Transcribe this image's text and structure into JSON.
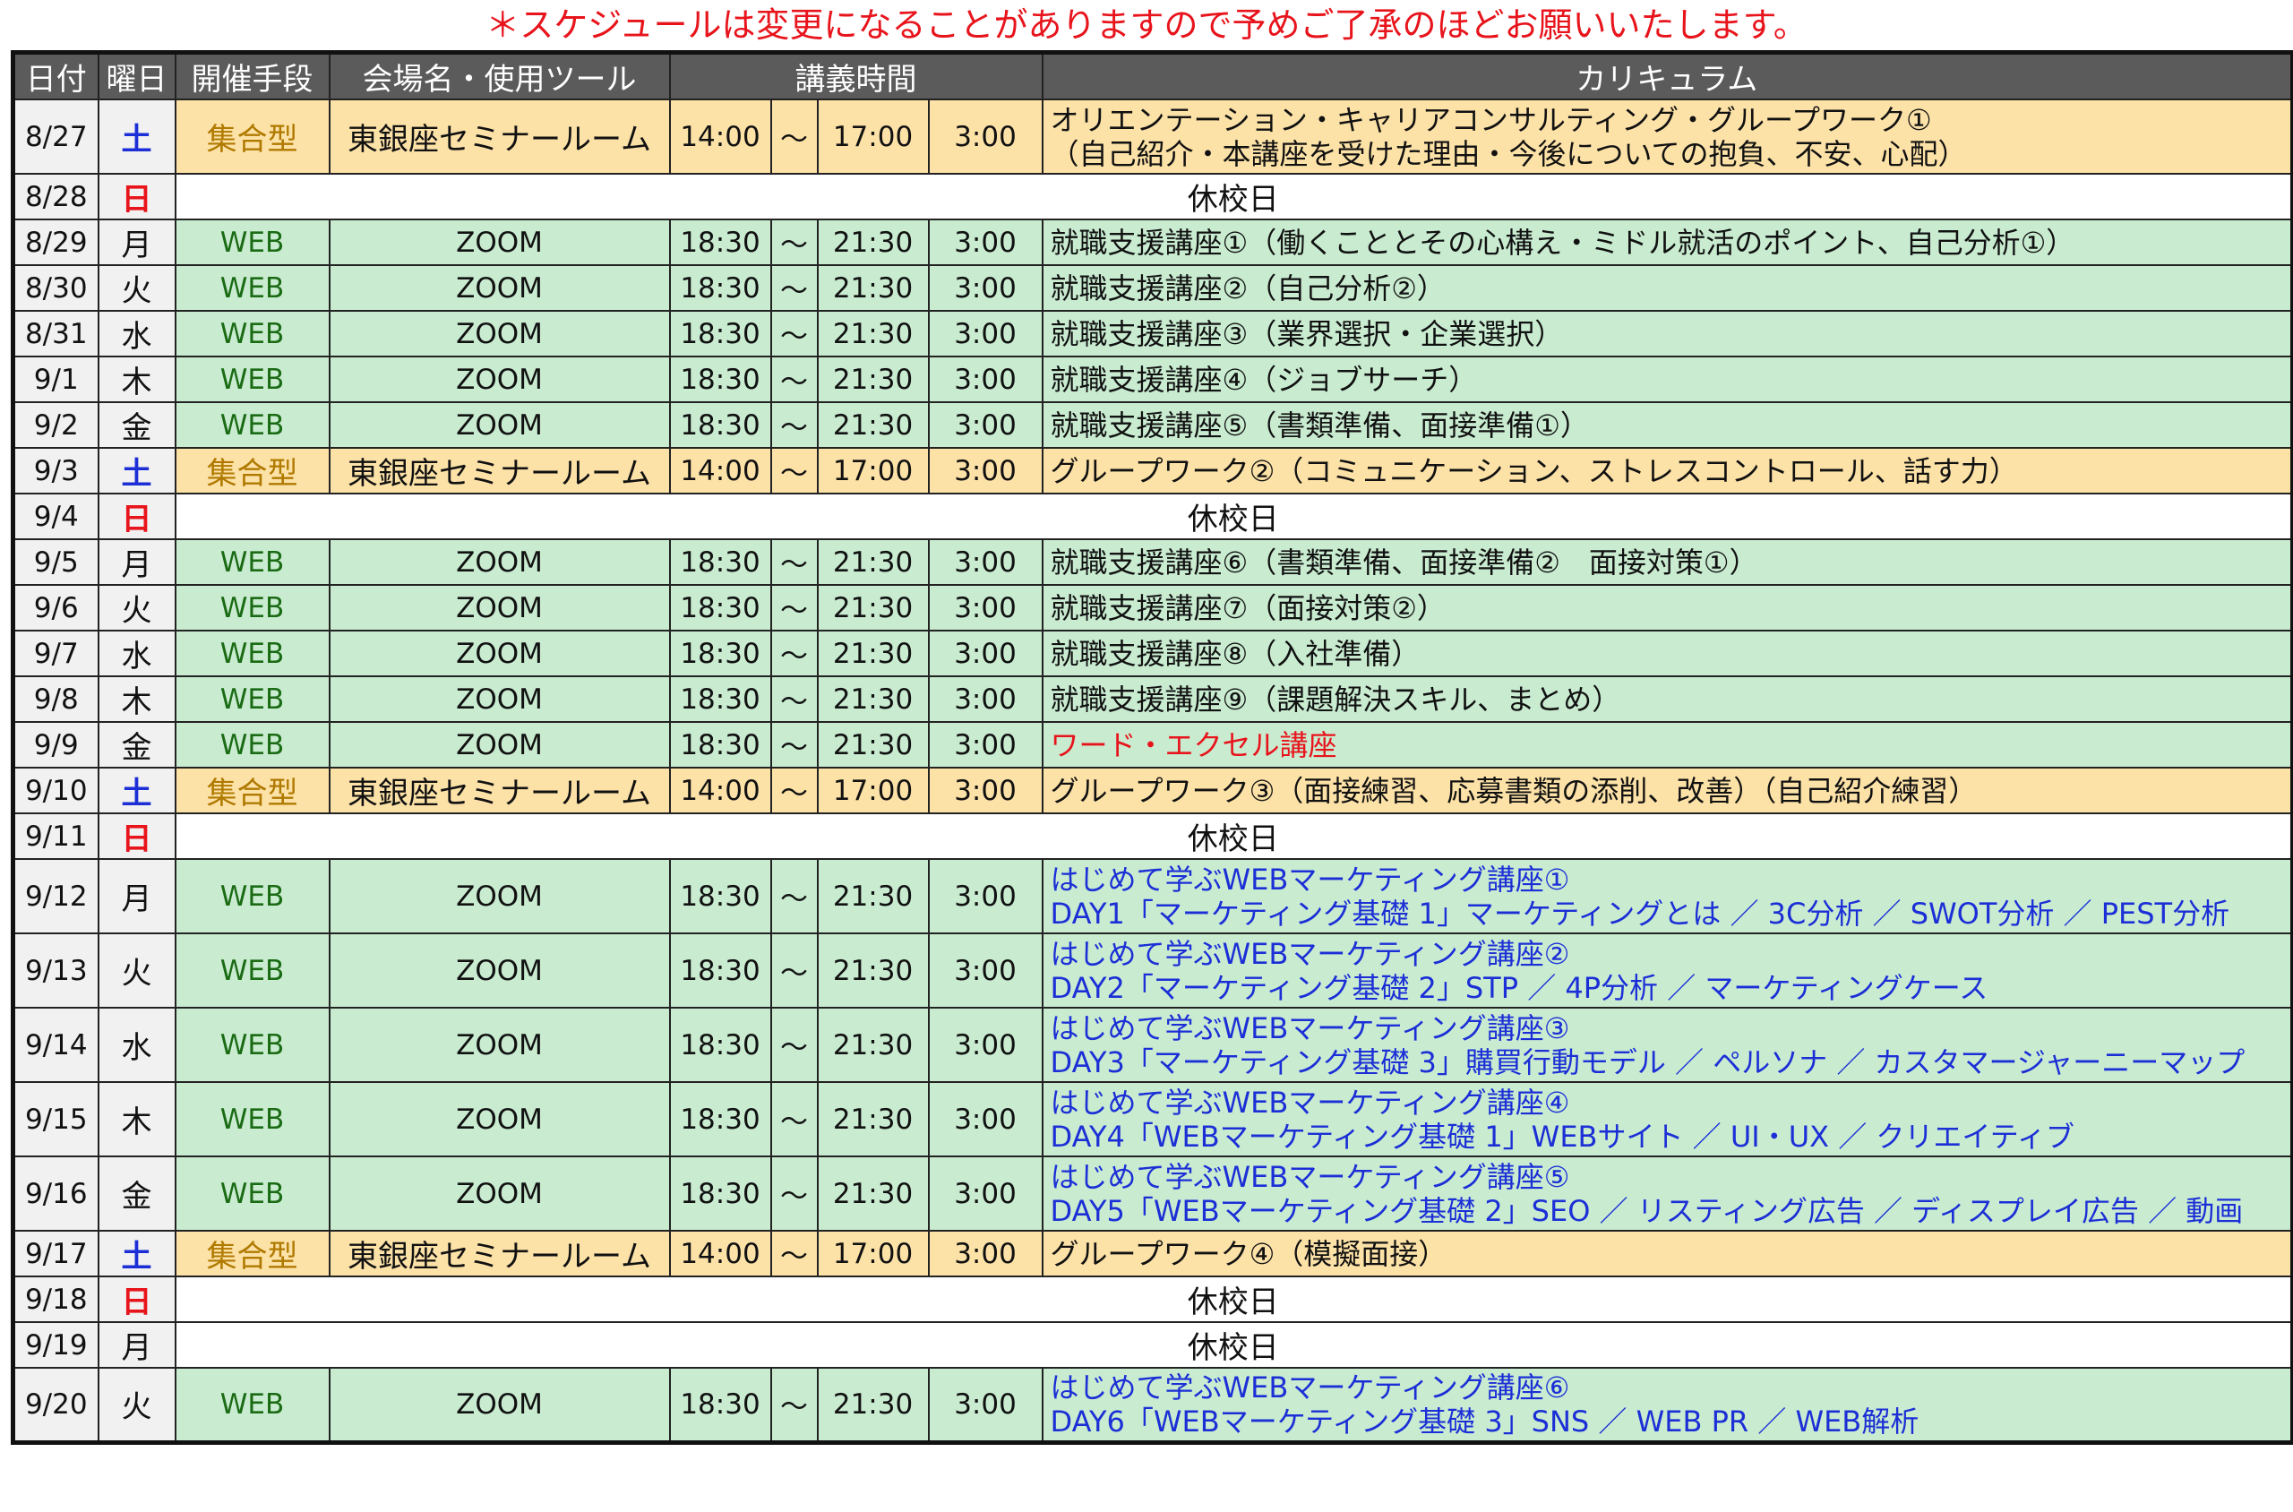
{
  "notice": "＊スケジュールは変更になることがありますので予めご了承のほどお願いいたします。",
  "headers": [
    "日付",
    "曜日",
    "開催手段",
    "会場名・使用ツール",
    "講義時間",
    "カリキュラム"
  ],
  "rows": [
    {
      "date": "8/27",
      "dow": "土",
      "dow_color": "blue",
      "type": "group",
      "method": "集合型",
      "venue": "東銀座セミナールーム",
      "start": "14:00",
      "sep": "〜",
      "end": "17:00",
      "dur": "3:00",
      "curr": [
        "オリエンテーション・キャリアコンサルティング・グループワーク①",
        "（自己紹介・本講座を受けた理由・今後についての抱負、不安、心配）"
      ],
      "curr_color": "black"
    },
    {
      "date": "8/28",
      "dow": "日",
      "dow_color": "red",
      "type": "holiday",
      "holiday": "休校日"
    },
    {
      "date": "8/29",
      "dow": "月",
      "dow_color": "black",
      "type": "web",
      "method": "WEB",
      "venue": "ZOOM",
      "start": "18:30",
      "sep": "〜",
      "end": "21:30",
      "dur": "3:00",
      "curr": [
        "就職支援講座①（働くこととその心構え・ミドル就活のポイント、自己分析①）"
      ],
      "curr_color": "black"
    },
    {
      "date": "8/30",
      "dow": "火",
      "dow_color": "black",
      "type": "web",
      "method": "WEB",
      "venue": "ZOOM",
      "start": "18:30",
      "sep": "〜",
      "end": "21:30",
      "dur": "3:00",
      "curr": [
        "就職支援講座②（自己分析②）"
      ],
      "curr_color": "black"
    },
    {
      "date": "8/31",
      "dow": "水",
      "dow_color": "black",
      "type": "web",
      "method": "WEB",
      "venue": "ZOOM",
      "start": "18:30",
      "sep": "〜",
      "end": "21:30",
      "dur": "3:00",
      "curr": [
        "就職支援講座③（業界選択・企業選択）"
      ],
      "curr_color": "black"
    },
    {
      "date": "9/1",
      "dow": "木",
      "dow_color": "black",
      "type": "web",
      "method": "WEB",
      "venue": "ZOOM",
      "start": "18:30",
      "sep": "〜",
      "end": "21:30",
      "dur": "3:00",
      "curr": [
        "就職支援講座④（ジョブサーチ）"
      ],
      "curr_color": "black"
    },
    {
      "date": "9/2",
      "dow": "金",
      "dow_color": "black",
      "type": "web",
      "method": "WEB",
      "venue": "ZOOM",
      "start": "18:30",
      "sep": "〜",
      "end": "21:30",
      "dur": "3:00",
      "curr": [
        "就職支援講座⑤（書類準備、面接準備①）"
      ],
      "curr_color": "black"
    },
    {
      "date": "9/3",
      "dow": "土",
      "dow_color": "blue",
      "type": "group",
      "method": "集合型",
      "venue": "東銀座セミナールーム",
      "start": "14:00",
      "sep": "〜",
      "end": "17:00",
      "dur": "3:00",
      "curr": [
        "グループワーク②（コミュニケーション、ストレスコントロール、話す力）"
      ],
      "curr_color": "black"
    },
    {
      "date": "9/4",
      "dow": "日",
      "dow_color": "red",
      "type": "holiday",
      "holiday": "休校日"
    },
    {
      "date": "9/5",
      "dow": "月",
      "dow_color": "black",
      "type": "web",
      "method": "WEB",
      "venue": "ZOOM",
      "start": "18:30",
      "sep": "〜",
      "end": "21:30",
      "dur": "3:00",
      "curr": [
        "就職支援講座⑥（書類準備、面接準備②　面接対策①）"
      ],
      "curr_color": "black"
    },
    {
      "date": "9/6",
      "dow": "火",
      "dow_color": "black",
      "type": "web",
      "method": "WEB",
      "venue": "ZOOM",
      "start": "18:30",
      "sep": "〜",
      "end": "21:30",
      "dur": "3:00",
      "curr": [
        "就職支援講座⑦（面接対策②）"
      ],
      "curr_color": "black"
    },
    {
      "date": "9/7",
      "dow": "水",
      "dow_color": "black",
      "type": "web",
      "method": "WEB",
      "venue": "ZOOM",
      "start": "18:30",
      "sep": "〜",
      "end": "21:30",
      "dur": "3:00",
      "curr": [
        "就職支援講座⑧（入社準備）"
      ],
      "curr_color": "black"
    },
    {
      "date": "9/8",
      "dow": "木",
      "dow_color": "black",
      "type": "web",
      "method": "WEB",
      "venue": "ZOOM",
      "start": "18:30",
      "sep": "〜",
      "end": "21:30",
      "dur": "3:00",
      "curr": [
        "就職支援講座⑨（課題解決スキル、まとめ）"
      ],
      "curr_color": "black"
    },
    {
      "date": "9/9",
      "dow": "金",
      "dow_color": "black",
      "type": "web",
      "method": "WEB",
      "venue": "ZOOM",
      "start": "18:30",
      "sep": "〜",
      "end": "21:30",
      "dur": "3:00",
      "curr": [
        "ワード・エクセル講座"
      ],
      "curr_color": "red"
    },
    {
      "date": "9/10",
      "dow": "土",
      "dow_color": "blue",
      "type": "group",
      "method": "集合型",
      "venue": "東銀座セミナールーム",
      "start": "14:00",
      "sep": "〜",
      "end": "17:00",
      "dur": "3:00",
      "curr": [
        "グループワーク③（面接練習、応募書類の添削、改善）（自己紹介練習）"
      ],
      "curr_color": "black"
    },
    {
      "date": "9/11",
      "dow": "日",
      "dow_color": "red",
      "type": "holiday",
      "holiday": "休校日"
    },
    {
      "date": "9/12",
      "dow": "月",
      "dow_color": "black",
      "type": "web",
      "method": "WEB",
      "venue": "ZOOM",
      "start": "18:30",
      "sep": "〜",
      "end": "21:30",
      "dur": "3:00",
      "curr": [
        "はじめて学ぶWEBマーケティング講座①",
        "DAY1「マーケティング基礎 1」マーケティングとは ／ 3C分析 ／ SWOT分析 ／ PEST分析"
      ],
      "curr_color": "blue"
    },
    {
      "date": "9/13",
      "dow": "火",
      "dow_color": "black",
      "type": "web",
      "method": "WEB",
      "venue": "ZOOM",
      "start": "18:30",
      "sep": "〜",
      "end": "21:30",
      "dur": "3:00",
      "curr": [
        "はじめて学ぶWEBマーケティング講座②",
        "DAY2「マーケティング基礎 2」STP ／ 4P分析 ／ マーケティングケース"
      ],
      "curr_color": "blue"
    },
    {
      "date": "9/14",
      "dow": "水",
      "dow_color": "black",
      "type": "web",
      "method": "WEB",
      "venue": "ZOOM",
      "start": "18:30",
      "sep": "〜",
      "end": "21:30",
      "dur": "3:00",
      "curr": [
        "はじめて学ぶWEBマーケティング講座③",
        "DAY3「マーケティング基礎 3」購買行動モデル ／ ペルソナ ／ カスタマージャーニーマップ"
      ],
      "curr_color": "blue"
    },
    {
      "date": "9/15",
      "dow": "木",
      "dow_color": "black",
      "type": "web",
      "method": "WEB",
      "venue": "ZOOM",
      "start": "18:30",
      "sep": "〜",
      "end": "21:30",
      "dur": "3:00",
      "curr": [
        "はじめて学ぶWEBマーケティング講座④",
        "DAY4「WEBマーケティング基礎 1」WEBサイト ／ UI・UX ／ クリエイティブ"
      ],
      "curr_color": "blue"
    },
    {
      "date": "9/16",
      "dow": "金",
      "dow_color": "black",
      "type": "web",
      "method": "WEB",
      "venue": "ZOOM",
      "start": "18:30",
      "sep": "〜",
      "end": "21:30",
      "dur": "3:00",
      "curr": [
        "はじめて学ぶWEBマーケティング講座⑤",
        "DAY5「WEBマーケティング基礎 2」SEO ／ リスティング広告 ／ ディスプレイ広告 ／ 動画"
      ],
      "curr_color": "blue"
    },
    {
      "date": "9/17",
      "dow": "土",
      "dow_color": "blue",
      "type": "group",
      "method": "集合型",
      "venue": "東銀座セミナールーム",
      "start": "14:00",
      "sep": "〜",
      "end": "17:00",
      "dur": "3:00",
      "curr": [
        "グループワーク④（模擬面接）"
      ],
      "curr_color": "black"
    },
    {
      "date": "9/18",
      "dow": "日",
      "dow_color": "red",
      "type": "holiday",
      "holiday": "休校日"
    },
    {
      "date": "9/19",
      "dow": "月",
      "dow_color": "black",
      "type": "holiday",
      "holiday": "休校日"
    },
    {
      "date": "9/20",
      "dow": "火",
      "dow_color": "black",
      "type": "web",
      "method": "WEB",
      "venue": "ZOOM",
      "start": "18:30",
      "sep": "〜",
      "end": "21:30",
      "dur": "3:00",
      "curr": [
        "はじめて学ぶWEBマーケティング講座⑥",
        "DAY6「WEBマーケティング基礎 3」SNS ／ WEB PR ／ WEB解析"
      ],
      "curr_color": "blue"
    }
  ]
}
